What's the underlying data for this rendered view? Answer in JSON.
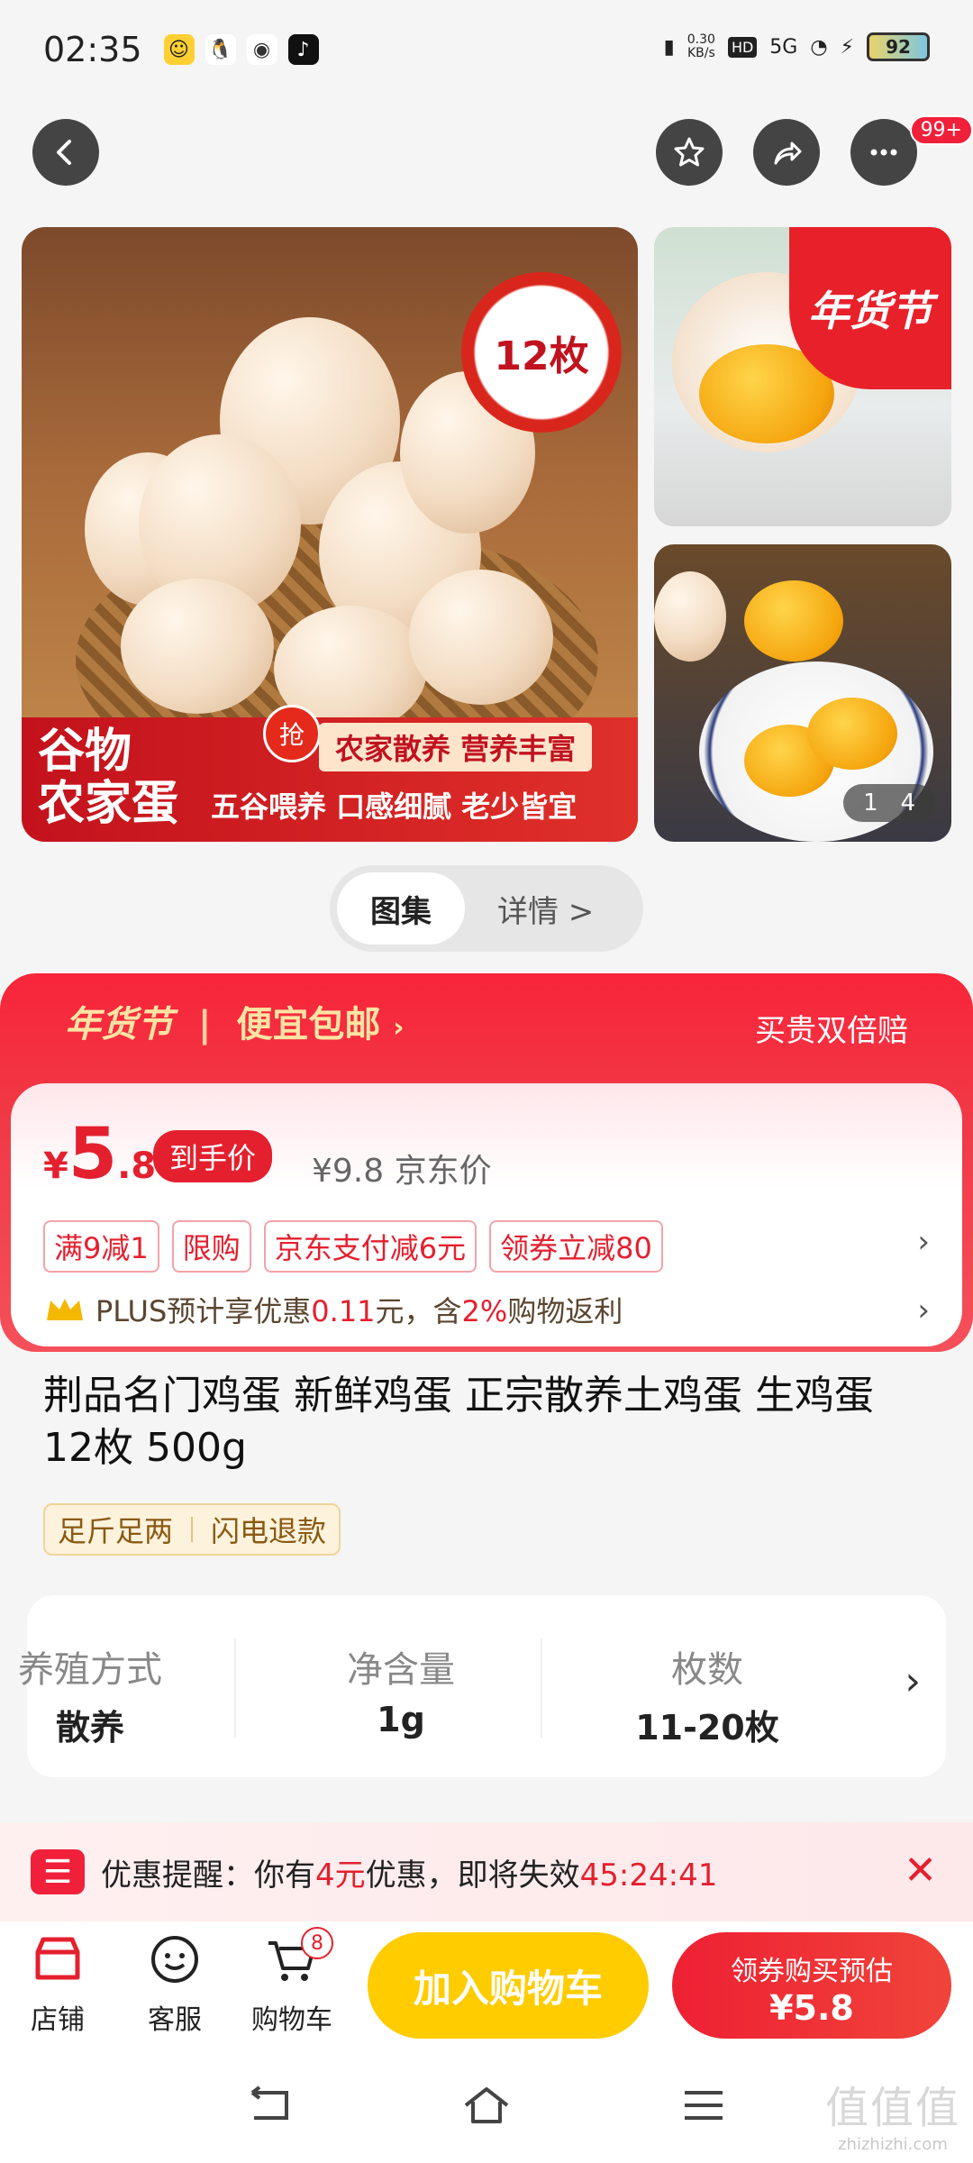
{
  "status_bar": {
    "time": "02:35",
    "net_speed": "0.30",
    "net_unit": "KB/s",
    "hd": "HD",
    "signal": "5G",
    "battery": "92"
  },
  "nav": {
    "more_badge": "99+"
  },
  "gallery": {
    "seal_text": "12枚",
    "banner_line1": "谷物",
    "banner_line2": "农家蛋",
    "grab_label": "抢",
    "banner_tag": "农家散养 营养丰富",
    "banner_slogan": "五谷喂养 口感细腻 老少皆宜",
    "festival": "年货节",
    "pager_current": "1",
    "pager_total": "4"
  },
  "segmented": {
    "gallery": "图集",
    "details": "详情 >"
  },
  "promo": {
    "festival": "年货节",
    "free_shipping": "便宜包邮",
    "guarantee": "买贵双倍赔",
    "currency": "¥",
    "price_int": "5",
    "price_dec": ".8",
    "hand_price_label": "到手价",
    "jd_price": "¥9.8 京东价",
    "chips": [
      "满9减1",
      "限购",
      "京东支付减6元",
      "领券立减80"
    ],
    "plus_prefix": "PLUS预计享优惠",
    "plus_amount": "0.11",
    "plus_mid": "元，含",
    "plus_pct": "2%",
    "plus_suffix": "购物返利",
    "chevron": "›"
  },
  "product": {
    "title": "荆品名门鸡蛋 新鲜鸡蛋 正宗散养土鸡蛋 生鸡蛋 12枚 500g",
    "tags": [
      "足斤足两",
      "闪电退款"
    ]
  },
  "specs": [
    {
      "label": "养殖方式",
      "value": "散养"
    },
    {
      "label": "净含量",
      "value": "1g"
    },
    {
      "label": "枚数",
      "value": "11-20枚"
    }
  ],
  "reminder": {
    "prefix": "优惠提醒：你有",
    "amount": "4元",
    "mid": "优惠，即将失效",
    "countdown": "45:24:41",
    "close": "✕"
  },
  "bottom_bar": {
    "shop": "店铺",
    "service": "客服",
    "cart": "购物车",
    "cart_count": "8",
    "add_to_cart": "加入购物车",
    "buy_line1": "领券购买预估",
    "buy_line2": "¥5.8"
  },
  "watermark": {
    "big": "值值值",
    "small": "zhizhizhi.com"
  },
  "colors": {
    "accent_red": "#e4202e",
    "cart_yellow": "#ffcc00"
  }
}
